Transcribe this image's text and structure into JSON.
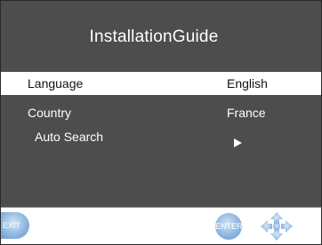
{
  "menu": {
    "title": "InstallationGuide",
    "items": [
      {
        "label": "Language",
        "value": "English"
      },
      {
        "label": "Country",
        "value": "France"
      },
      {
        "label": "Auto Search",
        "value": ""
      }
    ]
  },
  "footer": {
    "exit_label": "EXIT",
    "enter_label": "ENTER",
    "dpad_icon": "navigation-arrows-icon"
  },
  "colors": {
    "panel": "#4d4d4d",
    "selected_row": "#ffffff",
    "button_blue": "#8fb6df"
  }
}
